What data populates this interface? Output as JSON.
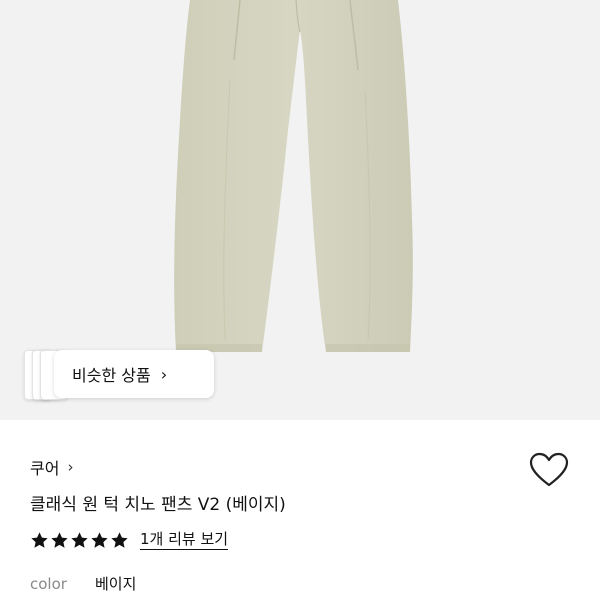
{
  "similar": {
    "label": "비슷한 상품",
    "chevron": "›"
  },
  "product": {
    "brand": "쿠어",
    "brand_chevron": "›",
    "title": "클래식 원 턱 치노 팬츠 V2 (베이지)",
    "rating": 5,
    "rating_max": 5,
    "review_link": "1개 리뷰 보기",
    "color_label": "color",
    "color_value": "베이지"
  },
  "icons": {
    "wishlist": "heart-outline-icon",
    "star": "star-icon"
  },
  "colors": {
    "pants": "#d3d3bf",
    "image_bg": "#f2f2f2",
    "label_gray": "#8a8a8a"
  }
}
